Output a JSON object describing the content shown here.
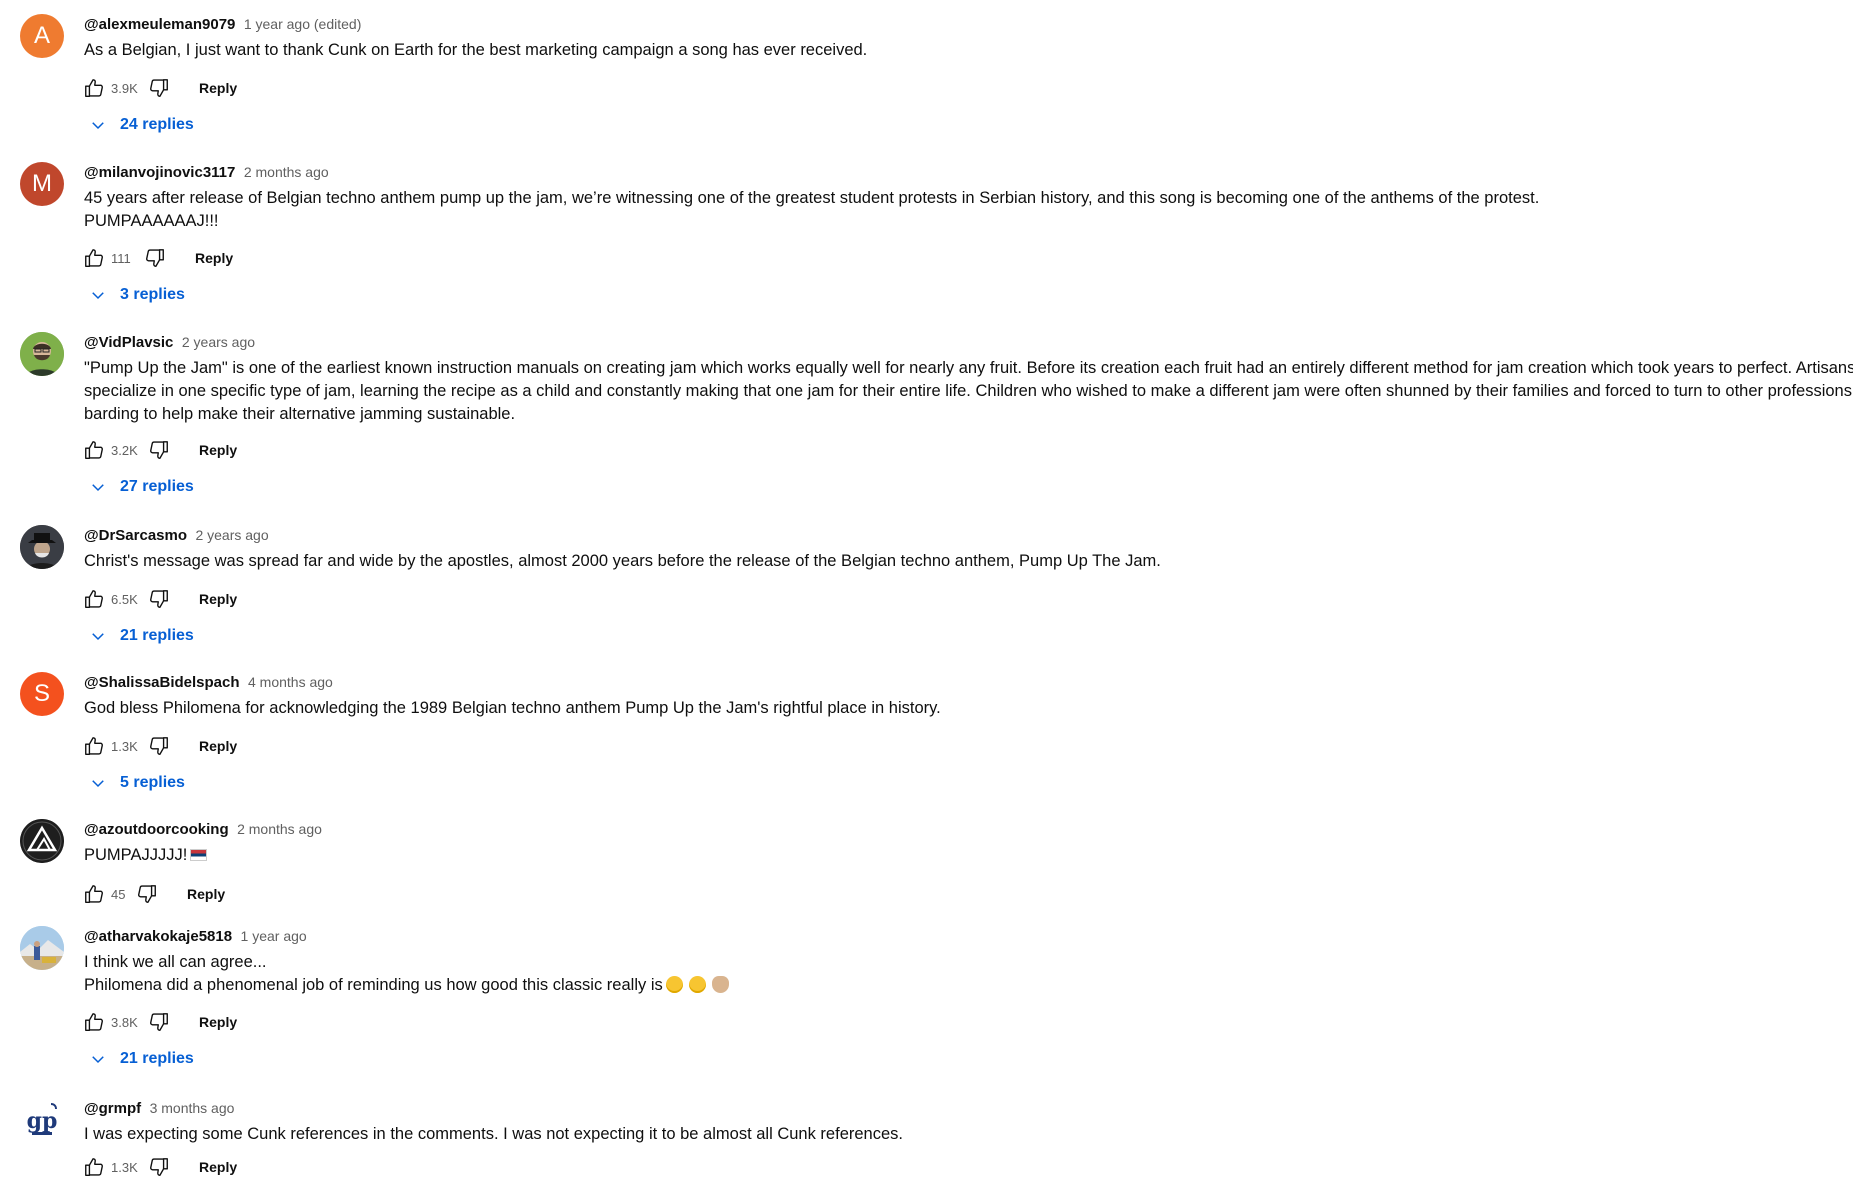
{
  "comments": [
    {
      "author": "@alexmeuleman9079",
      "time": "1 year ago (edited)",
      "avatar_letter": "A",
      "avatar_color": "#ef7b30",
      "lines": [
        "As a Belgian, I just want to thank Cunk on Earth for the best marketing campaign a song has ever received."
      ],
      "likes": "3.9K",
      "reply_label": "Reply",
      "replies_label": "24 replies"
    },
    {
      "author": "@milanvojinovic3117",
      "time": "2 months ago",
      "avatar_letter": "M",
      "avatar_color": "#c0472c",
      "lines": [
        "45 years after release of Belgian techno anthem pump up the jam, we’re witnessing one of the greatest student protests in Serbian history, and this song is becoming one of the anthems of the protest.",
        "PUMPAAAAAAJ!!!"
      ],
      "likes": "111",
      "reply_label": "Reply",
      "replies_label": "3 replies"
    },
    {
      "author": "@VidPlavsic",
      "time": "2 years ago",
      "avatar_image": "portrait-photo",
      "lines": [
        "\"Pump Up the Jam\" is one of the earliest known instruction manuals on creating jam which works equally well for nearly any fruit. Before its creation each fruit had an entirely different method for jam creation which took years to perfect. Artisans would",
        "specialize in one specific type of jam, learning the recipe as a child and constantly making that one jam for their entire life. Children who wished to make a different jam were often shunned by their families and forced to turn to other professions such as",
        "barding to help make their alternative jamming sustainable."
      ],
      "likes": "3.2K",
      "reply_label": "Reply",
      "replies_label": "27 replies"
    },
    {
      "author": "@DrSarcasmo",
      "time": "2 years ago",
      "avatar_image": "hat-portrait",
      "lines": [
        "Christ's message was spread far and wide by the apostles, almost 2000 years before the release of the Belgian techno anthem, Pump Up The Jam."
      ],
      "likes": "6.5K",
      "reply_label": "Reply",
      "replies_label": "21 replies"
    },
    {
      "author": "@ShalissaBidelspach",
      "time": "4 months ago",
      "avatar_letter": "S",
      "avatar_color": "#f4511e",
      "lines": [
        "God bless Philomena for acknowledging  the 1989 Belgian techno anthem Pump Up the Jam's rightful place in history."
      ],
      "likes": "1.3K",
      "reply_label": "Reply",
      "replies_label": "5 replies"
    },
    {
      "author": "@azoutdoorcooking",
      "time": "2 months ago",
      "avatar_image": "triangle-logo",
      "lines": [
        "PUMPAJJJJJ!"
      ],
      "emoji_flag": "serbia-flag",
      "likes": "45",
      "reply_label": "Reply",
      "replies_label": ""
    },
    {
      "author": "@atharvakokaje5818",
      "time": "1 year ago",
      "avatar_image": "landscape-photo",
      "lines": [
        "I think we all can agree...",
        "Philomena did a phenomenal job of reminding us how good this classic really is"
      ],
      "emoji_faces": [
        "relieved-face",
        "laughing-face",
        "clapping-hands"
      ],
      "likes": "3.8K",
      "reply_label": "Reply",
      "replies_label": "21 replies"
    },
    {
      "author": "@grmpf",
      "time": "3 months ago",
      "avatar_image": "gp-monogram",
      "lines": [
        "I was expecting some Cunk references in the comments. I was not expecting it to be almost all Cunk references."
      ],
      "likes": "1.3K",
      "reply_label": "Reply",
      "replies_label": ""
    }
  ],
  "colors": {
    "link_blue": "#065fd4",
    "meta_gray": "#606060",
    "text": "#0f0f0f"
  }
}
